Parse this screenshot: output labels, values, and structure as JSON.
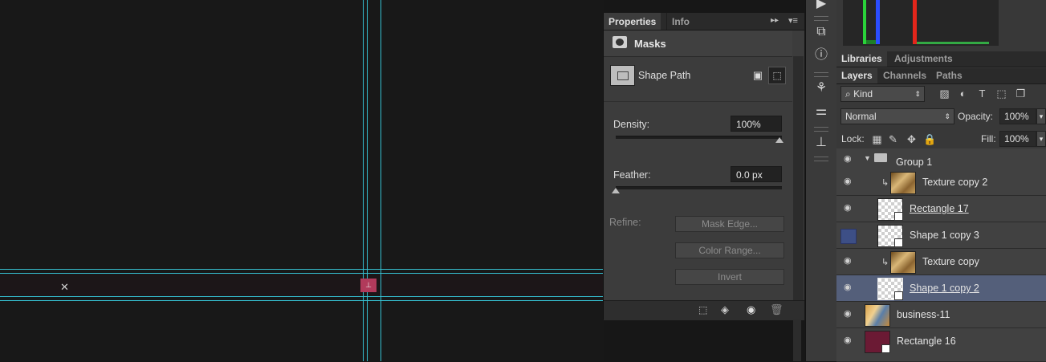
{
  "properties_panel": {
    "tabs": [
      "Properties",
      "Info"
    ],
    "section_title": "Masks",
    "mask_type": "Shape Path",
    "density_label": "Density:",
    "density_value": "100%",
    "density_level": 1.0,
    "feather_label": "Feather:",
    "feather_value": "0.0 px",
    "feather_level": 0.0,
    "refine_label": "Refine:",
    "buttons": [
      "Mask Edge...",
      "Color Range...",
      "Invert"
    ]
  },
  "panels_top_tabs": [
    "Libraries",
    "Adjustments"
  ],
  "layers_panel": {
    "tabs": [
      "Layers",
      "Channels",
      "Paths"
    ],
    "filter_kind": "Kind",
    "blend_mode": "Normal",
    "opacity_label": "Opacity:",
    "opacity_value": "100%",
    "lock_label": "Lock:",
    "fill_label": "Fill:",
    "fill_value": "100%",
    "layers": [
      {
        "name": "Group 1",
        "kind": "group"
      },
      {
        "name": "Texture copy 2",
        "kind": "texture-clipped"
      },
      {
        "name": "Rectangle 17",
        "kind": "shape"
      },
      {
        "name": "Shape 1 copy 3",
        "kind": "shape"
      },
      {
        "name": "Texture copy",
        "kind": "texture-clipped"
      },
      {
        "name": "Shape 1 copy 2",
        "kind": "shape-selected"
      },
      {
        "name": "business-11",
        "kind": "photo"
      },
      {
        "name": "Rectangle 16",
        "kind": "shape-filled"
      }
    ]
  },
  "colors": {
    "guide": "#35bfd0",
    "selected_layer": "#545f7a",
    "rectangle16_fill": "#6b1a34",
    "canvas_anchor": "#b13a5b"
  }
}
